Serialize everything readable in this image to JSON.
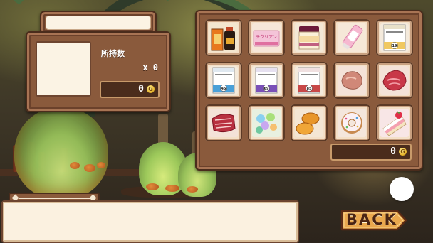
{
  "item_title": "",
  "item_info": {
    "owned_label": "所持数",
    "owned_count": "x 0",
    "price": "0",
    "currency_icon": "G"
  },
  "shop_items": [
    {
      "name": "medicine-bottle-item-icon",
      "text": ""
    },
    {
      "name": "pink-candy-box-item-icon",
      "text": "チクリアン"
    },
    {
      "name": "pudding-jar-item-icon",
      "text": ""
    },
    {
      "name": "pink-tube-item-icon",
      "text": ""
    },
    {
      "name": "medicine-box-19-item-icon",
      "text": "19"
    },
    {
      "name": "medicine-box-45-item-icon",
      "text": "45"
    },
    {
      "name": "medicine-box-69-item-icon",
      "text": "69"
    },
    {
      "name": "medicine-box-85-item-icon",
      "text": "85"
    },
    {
      "name": "raw-meat-item-icon",
      "text": ""
    },
    {
      "name": "red-meat-steak-item-icon",
      "text": ""
    },
    {
      "name": "marbled-beef-item-icon",
      "text": ""
    },
    {
      "name": "candy-item-icon",
      "text": ""
    },
    {
      "name": "croquette-item-icon",
      "text": ""
    },
    {
      "name": "donut-item-icon",
      "text": ""
    },
    {
      "name": "strawberry-cake-item-icon",
      "text": ""
    }
  ],
  "total": {
    "value": "0",
    "currency_icon": "G"
  },
  "dialogue_text": "",
  "back_button": {
    "label": "BACK"
  },
  "colors": {
    "frame": "#8a5a3c",
    "frame_dark": "#4a2c1c",
    "panel_bg": "#fbf3e4",
    "back_button": "#e8a850"
  }
}
